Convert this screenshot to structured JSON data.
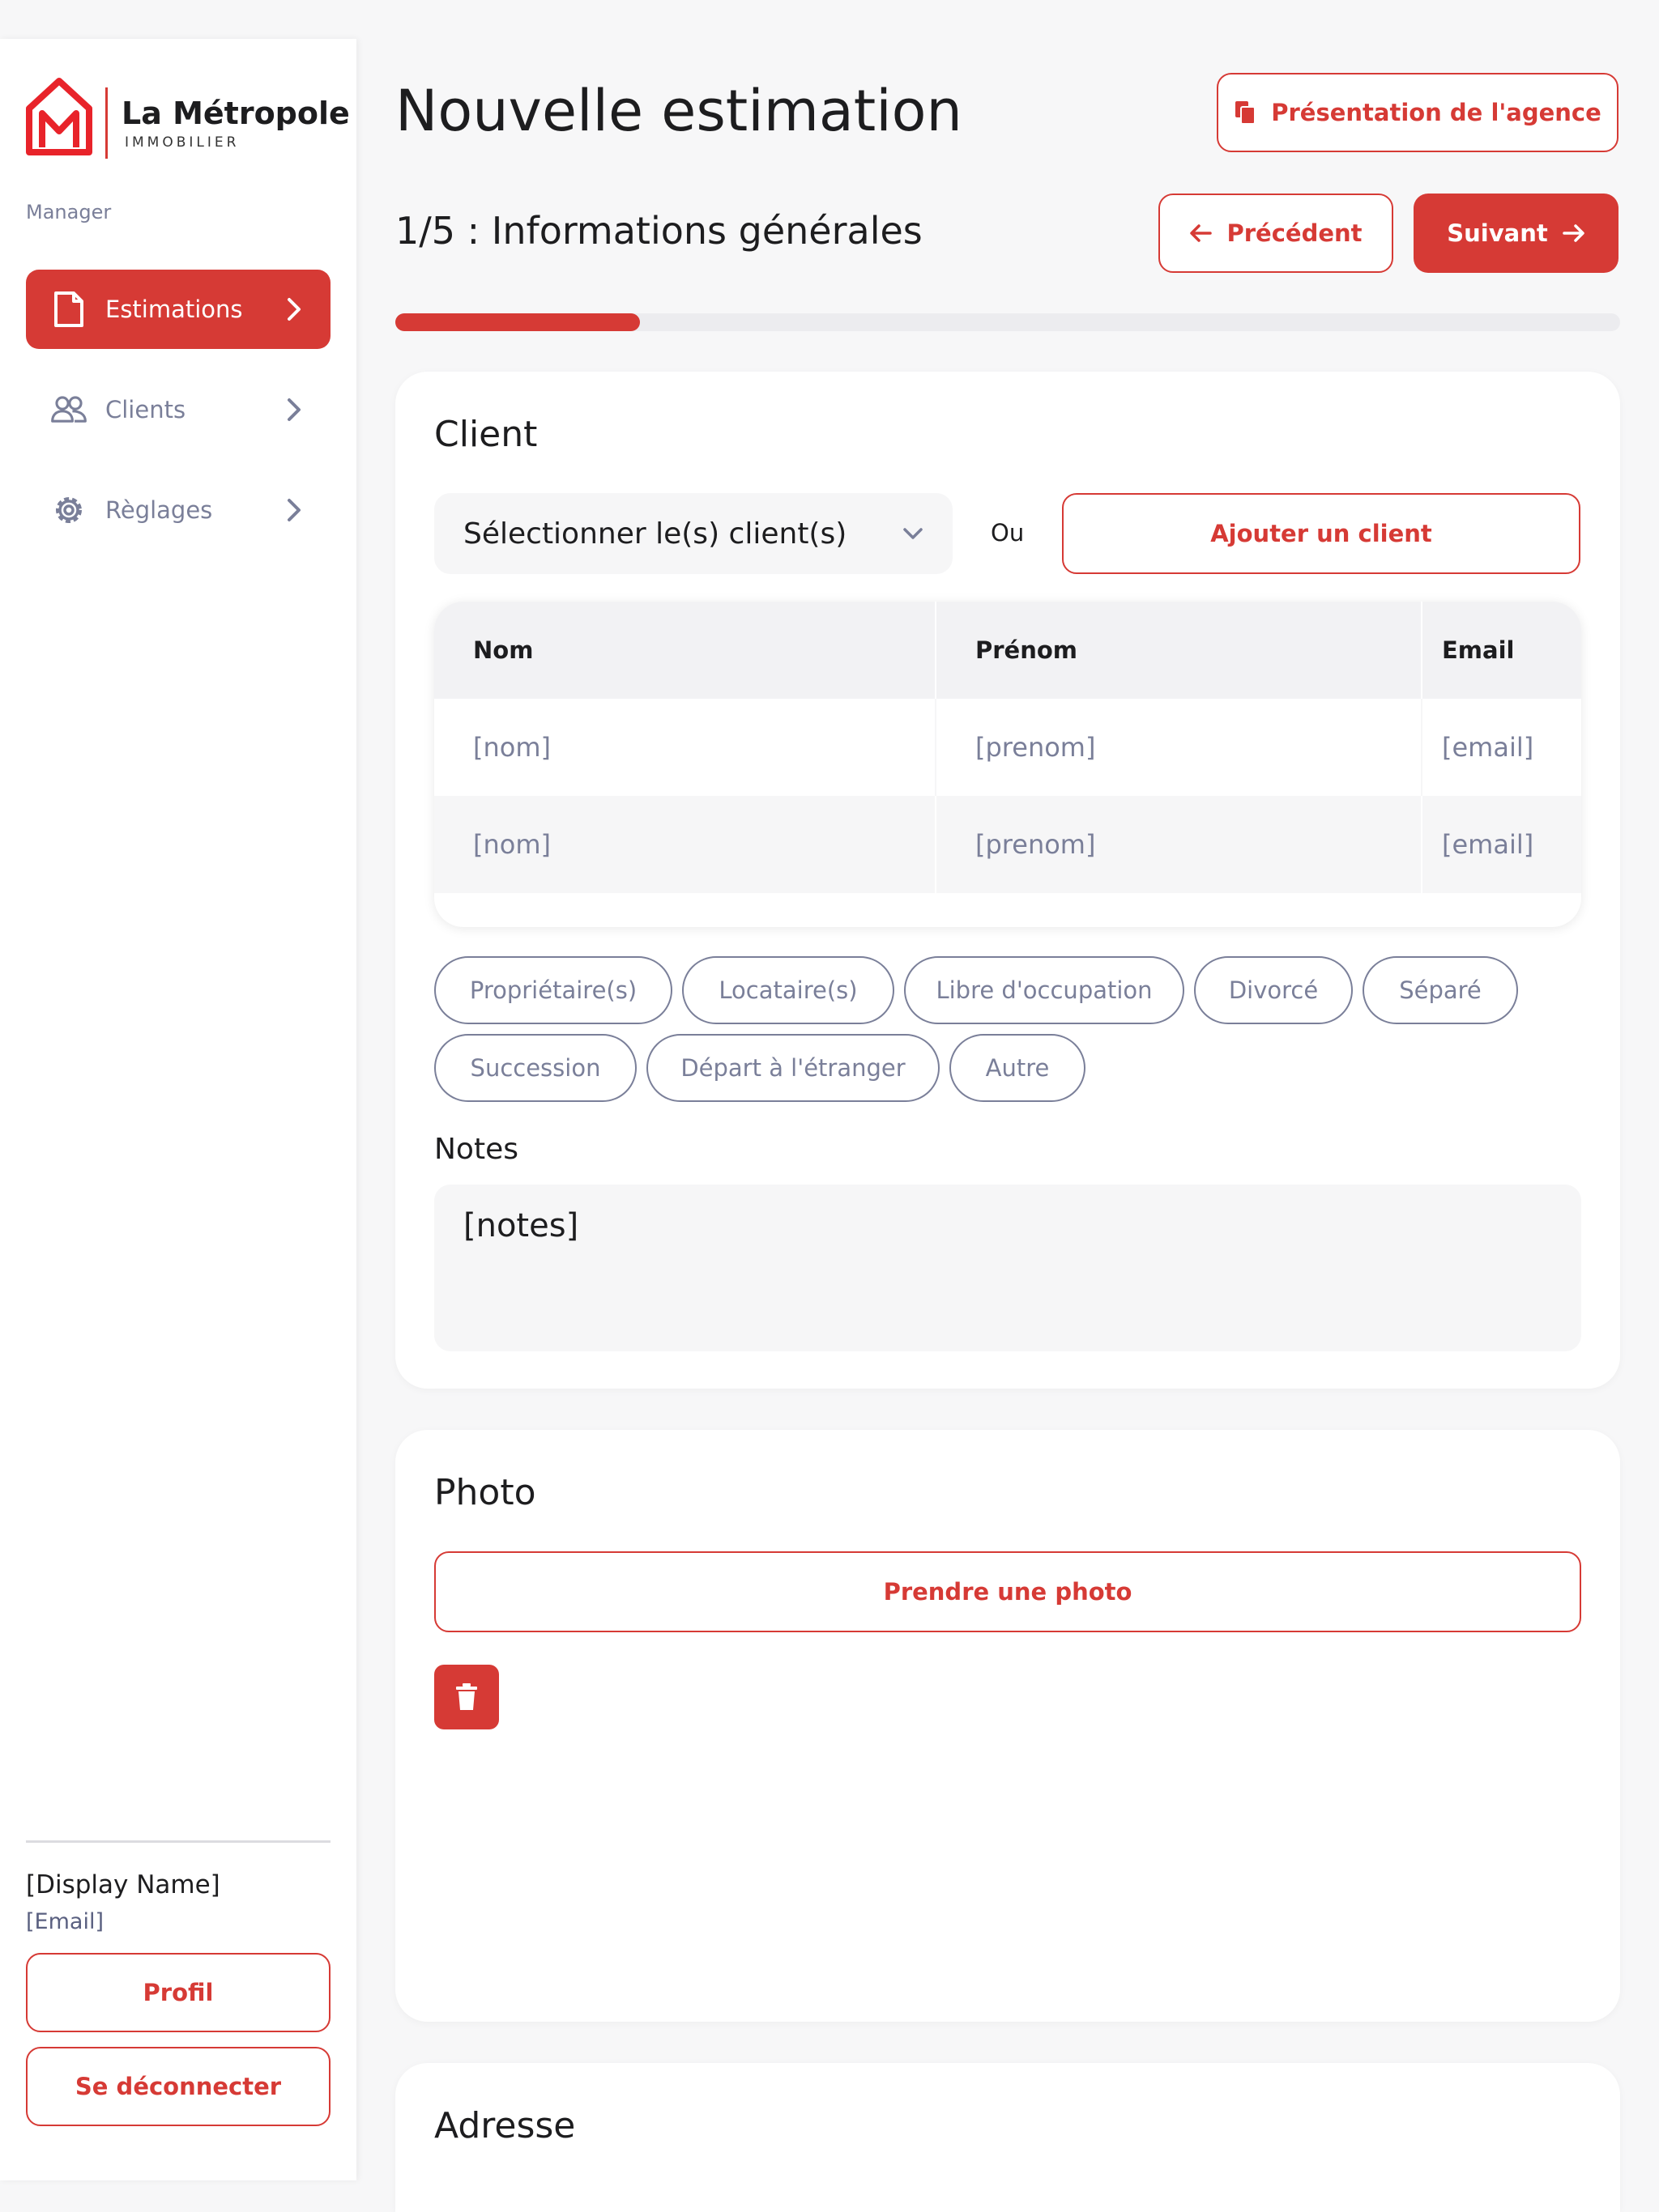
{
  "brand": {
    "name": "La Métropole",
    "subtitle": "IMMOBILIER",
    "accent": "#d63a35"
  },
  "sidebar": {
    "role": "Manager",
    "items": [
      {
        "label": "Estimations",
        "icon": "document-icon",
        "active": true
      },
      {
        "label": "Clients",
        "icon": "users-icon",
        "active": false
      },
      {
        "label": "Règlages",
        "icon": "gear-icon",
        "active": false
      }
    ],
    "user": {
      "display_name": "[Display Name]",
      "email": "[Email]"
    },
    "profile_label": "Profil",
    "logout_label": "Se déconnecter"
  },
  "header": {
    "title": "Nouvelle estimation",
    "agency_button": "Présentation de l'agence",
    "step_title": "1/5 : Informations générales",
    "prev_label": "Précédent",
    "next_label": "Suivant",
    "progress": 0.2
  },
  "client_card": {
    "title": "Client",
    "select_value": "Sélectionner le(s) client(s)",
    "or_label": "Ou",
    "add_button": "Ajouter un client",
    "table": {
      "headers": [
        "Nom",
        "Prénom",
        "Email"
      ],
      "rows": [
        [
          "[nom]",
          "[prenom]",
          "[email]"
        ],
        [
          "[nom]",
          "[prenom]",
          "[email]"
        ]
      ]
    },
    "chips": [
      "Propriétaire(s)",
      "Locataire(s)",
      "Libre d'occupation",
      "Divorcé",
      "Séparé",
      "Succession",
      "Départ à l'étranger",
      "Autre"
    ],
    "notes_label": "Notes",
    "notes_value": "[notes]"
  },
  "photo_card": {
    "title": "Photo",
    "take_photo_button": "Prendre une photo"
  },
  "address_card": {
    "title": "Adresse"
  }
}
